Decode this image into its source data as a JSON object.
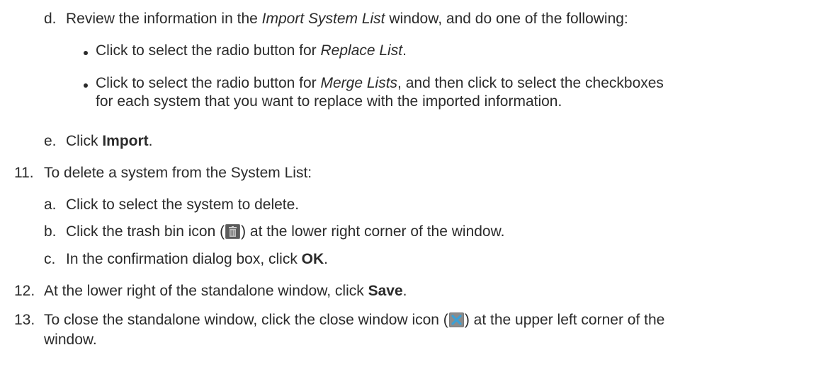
{
  "steps": {
    "d": {
      "marker": "d.",
      "t1": "Review the information in the ",
      "t2": "Import System List",
      "t3": " window, and do one of the following:",
      "bullets": [
        {
          "t1": "Click to select the radio button for ",
          "t2": "Replace List",
          "t3": "."
        },
        {
          "t1": "Click to select the radio button for ",
          "t2": "Merge Lists",
          "t3": ", and then click to select the checkboxes",
          "line2": "for each system that you want to replace with the imported information."
        }
      ]
    },
    "e": {
      "marker": "e.",
      "t1": "Click ",
      "t2": "Import",
      "t3": "."
    },
    "s11": {
      "marker": "11.",
      "text": "To delete a system from the System List:",
      "a": {
        "marker": "a.",
        "text": "Click to select the system to delete."
      },
      "b": {
        "marker": "b.",
        "t1": "Click the trash bin icon (",
        "t2": ") at the lower right corner of the window."
      },
      "c": {
        "marker": "c.",
        "t1": "In the confirmation dialog box, click ",
        "t2": "OK",
        "t3": "."
      }
    },
    "s12": {
      "marker": "12.",
      "t1": "At the lower right of the standalone window, click ",
      "t2": "Save",
      "t3": "."
    },
    "s13": {
      "marker": "13.",
      "t1": "To close the standalone window, click the close window icon (",
      "t2": ") at the upper left corner of the",
      "line2": "window."
    }
  },
  "icons": {
    "trash": "trash-bin-icon",
    "close": "close-window-icon"
  }
}
